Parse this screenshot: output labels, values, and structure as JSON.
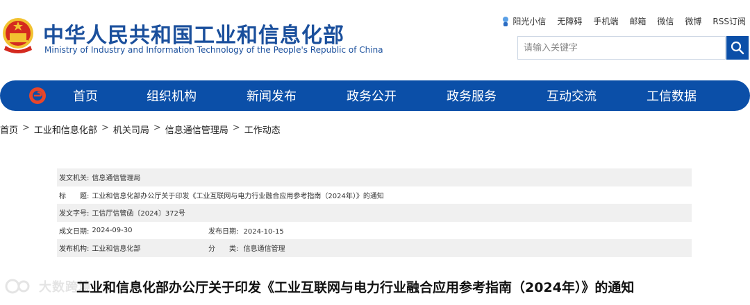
{
  "header": {
    "title": "中华人民共和国工业和信息化部",
    "subtitle": "Ministry of Industry and Information Technology of the People's Republic of China"
  },
  "toplinks": [
    "阳光小信",
    "无障碍",
    "手机端",
    "邮箱",
    "微信",
    "微博",
    "RSS订阅"
  ],
  "search": {
    "placeholder": "请输入关键字",
    "value": ""
  },
  "nav": [
    "首页",
    "组织机构",
    "新闻发布",
    "政务公开",
    "政务服务",
    "互动交流",
    "工信数据"
  ],
  "breadcrumb": [
    "首页",
    "工业和信息化部",
    "机关司局",
    "信息通信管理局",
    "工作动态"
  ],
  "breadcrumb_sep": ">",
  "info": {
    "issuer_label": "发文机关:",
    "issuer": "信息通信管理局",
    "title_label": "标　　题:",
    "title": "工业和信息化部办公厅关于印发《工业互联网与电力行业融合应用参考指南（2024年）》的通知",
    "doc_no_label": "发文字号:",
    "doc_no": "工信厅信管函〔2024〕372号",
    "created_label": "成文日期:",
    "created": "2024-09-30",
    "published_label": "发布日期:",
    "published": "2024-10-15",
    "org_label": "发布机构:",
    "org": "工业和信息化部",
    "category_label": "分　　类:",
    "category": "信息通信管理"
  },
  "article_title": "工业和信息化部办公厅关于印发《工业互联网与电力行业融合应用参考指南（2024年）》的通知",
  "watermark": "大数跨境",
  "colors": {
    "brand_blue": "#0b4fa8",
    "title_blue": "#1a4f9c",
    "emblem_red": "#d42a1f",
    "emblem_gold": "#f2c230"
  }
}
